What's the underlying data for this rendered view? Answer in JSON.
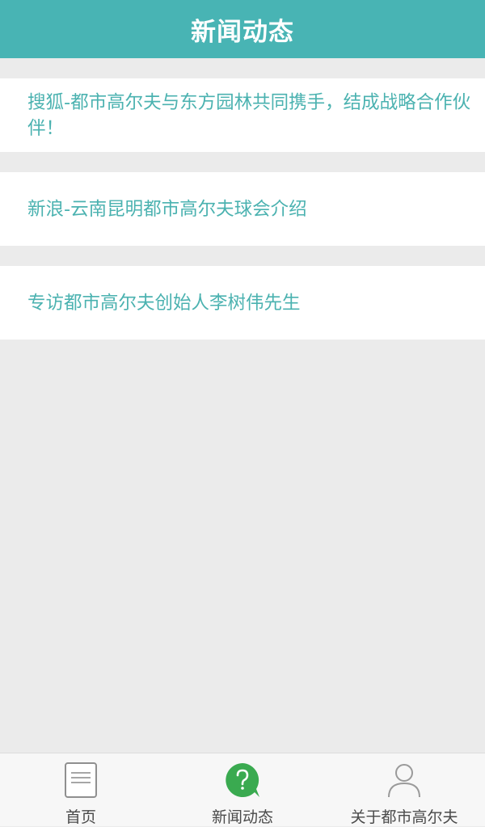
{
  "header": {
    "title": "新闻动态"
  },
  "news": [
    {
      "title": "搜狐-都市高尔夫与东方园林共同携手，结成战略合作伙伴！"
    },
    {
      "title": "新浪-云南昆明都市高尔夫球会介绍"
    },
    {
      "title": "专访都市高尔夫创始人李树伟先生"
    }
  ],
  "tabbar": {
    "tabs": [
      {
        "label": "首页",
        "icon": "document-icon",
        "active": false
      },
      {
        "label": "新闻动态",
        "icon": "question-bubble-icon",
        "active": true
      },
      {
        "label": "关于都市高尔夫",
        "icon": "user-icon",
        "active": false
      }
    ]
  },
  "colors": {
    "accent": "#48b4b4",
    "news_text": "#4bb2b0",
    "active_icon": "#3aaa50",
    "background": "#ebebeb"
  }
}
